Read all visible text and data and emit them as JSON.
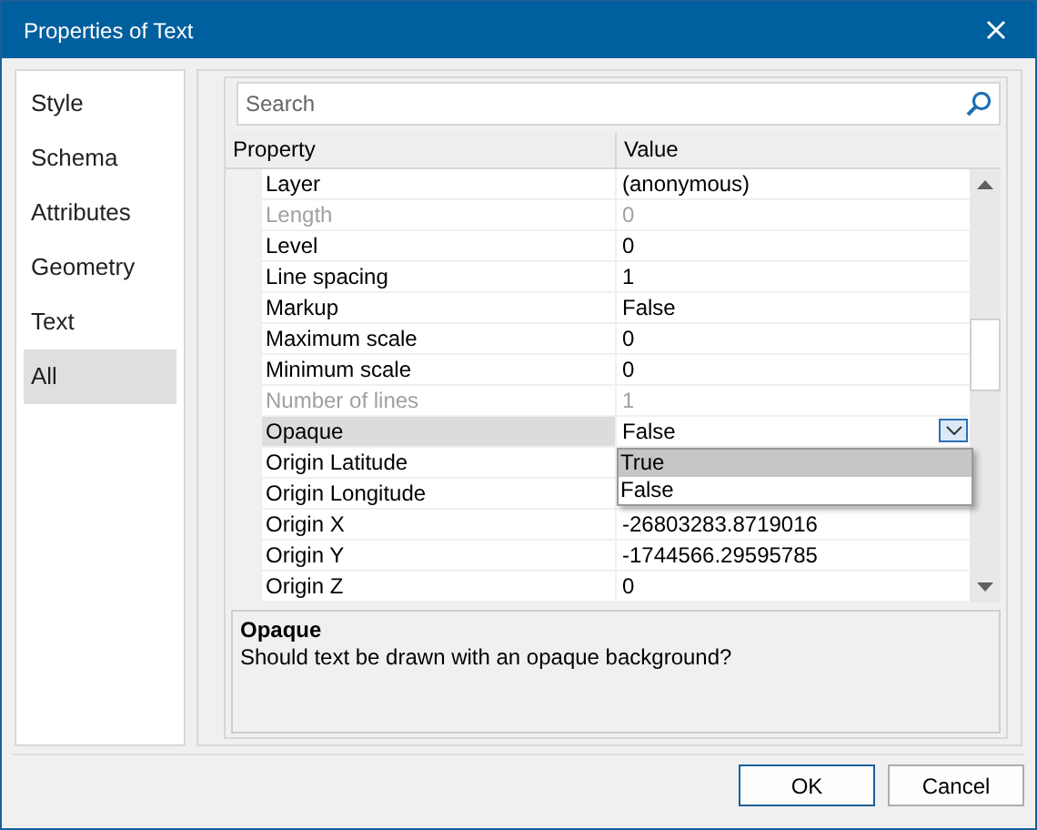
{
  "window": {
    "title": "Properties of Text"
  },
  "sidebar": {
    "items": [
      {
        "label": "Style",
        "selected": false
      },
      {
        "label": "Schema",
        "selected": false
      },
      {
        "label": "Attributes",
        "selected": false
      },
      {
        "label": "Geometry",
        "selected": false
      },
      {
        "label": "Text",
        "selected": false
      },
      {
        "label": "All",
        "selected": true
      }
    ]
  },
  "search": {
    "placeholder": "Search"
  },
  "grid": {
    "columns": [
      "Property",
      "Value"
    ],
    "rows": [
      {
        "name": "Layer",
        "value": "(anonymous)",
        "kind": "text",
        "disabled": false,
        "selected": false
      },
      {
        "name": "Length",
        "value": "0",
        "kind": "text",
        "disabled": true,
        "selected": false
      },
      {
        "name": "Level",
        "value": "0",
        "kind": "text",
        "disabled": false,
        "selected": false
      },
      {
        "name": "Line spacing",
        "value": "1",
        "kind": "text",
        "disabled": false,
        "selected": false
      },
      {
        "name": "Markup",
        "value": "False",
        "kind": "text",
        "disabled": false,
        "selected": false
      },
      {
        "name": "Maximum scale",
        "value": "0",
        "kind": "text",
        "disabled": false,
        "selected": false
      },
      {
        "name": "Minimum scale",
        "value": "0",
        "kind": "text",
        "disabled": false,
        "selected": false
      },
      {
        "name": "Number of lines",
        "value": "1",
        "kind": "text",
        "disabled": true,
        "selected": false
      },
      {
        "name": "Opaque",
        "value": "False",
        "kind": "dropdown",
        "disabled": false,
        "selected": true
      },
      {
        "name": "Origin Latitude",
        "kind": "text",
        "disabled": false,
        "selected": false
      },
      {
        "name": "Origin Longitude",
        "kind": "text",
        "disabled": false,
        "selected": false
      },
      {
        "name": "Origin X",
        "value": "-26803283.8719016",
        "kind": "text",
        "disabled": false,
        "selected": false
      },
      {
        "name": "Origin Y",
        "value": "-1744566.29595785",
        "kind": "text",
        "disabled": false,
        "selected": false
      },
      {
        "name": "Origin Z",
        "value": "0",
        "kind": "text",
        "disabled": false,
        "selected": false
      }
    ]
  },
  "dropdown": {
    "options": [
      {
        "label": "True",
        "selected": true
      },
      {
        "label": "False",
        "selected": false
      }
    ]
  },
  "description": {
    "title": "Opaque",
    "text": "Should text be drawn with an opaque background?"
  },
  "buttons": [
    {
      "label": "OK",
      "default": true
    },
    {
      "label": "Cancel",
      "default": false
    }
  ]
}
